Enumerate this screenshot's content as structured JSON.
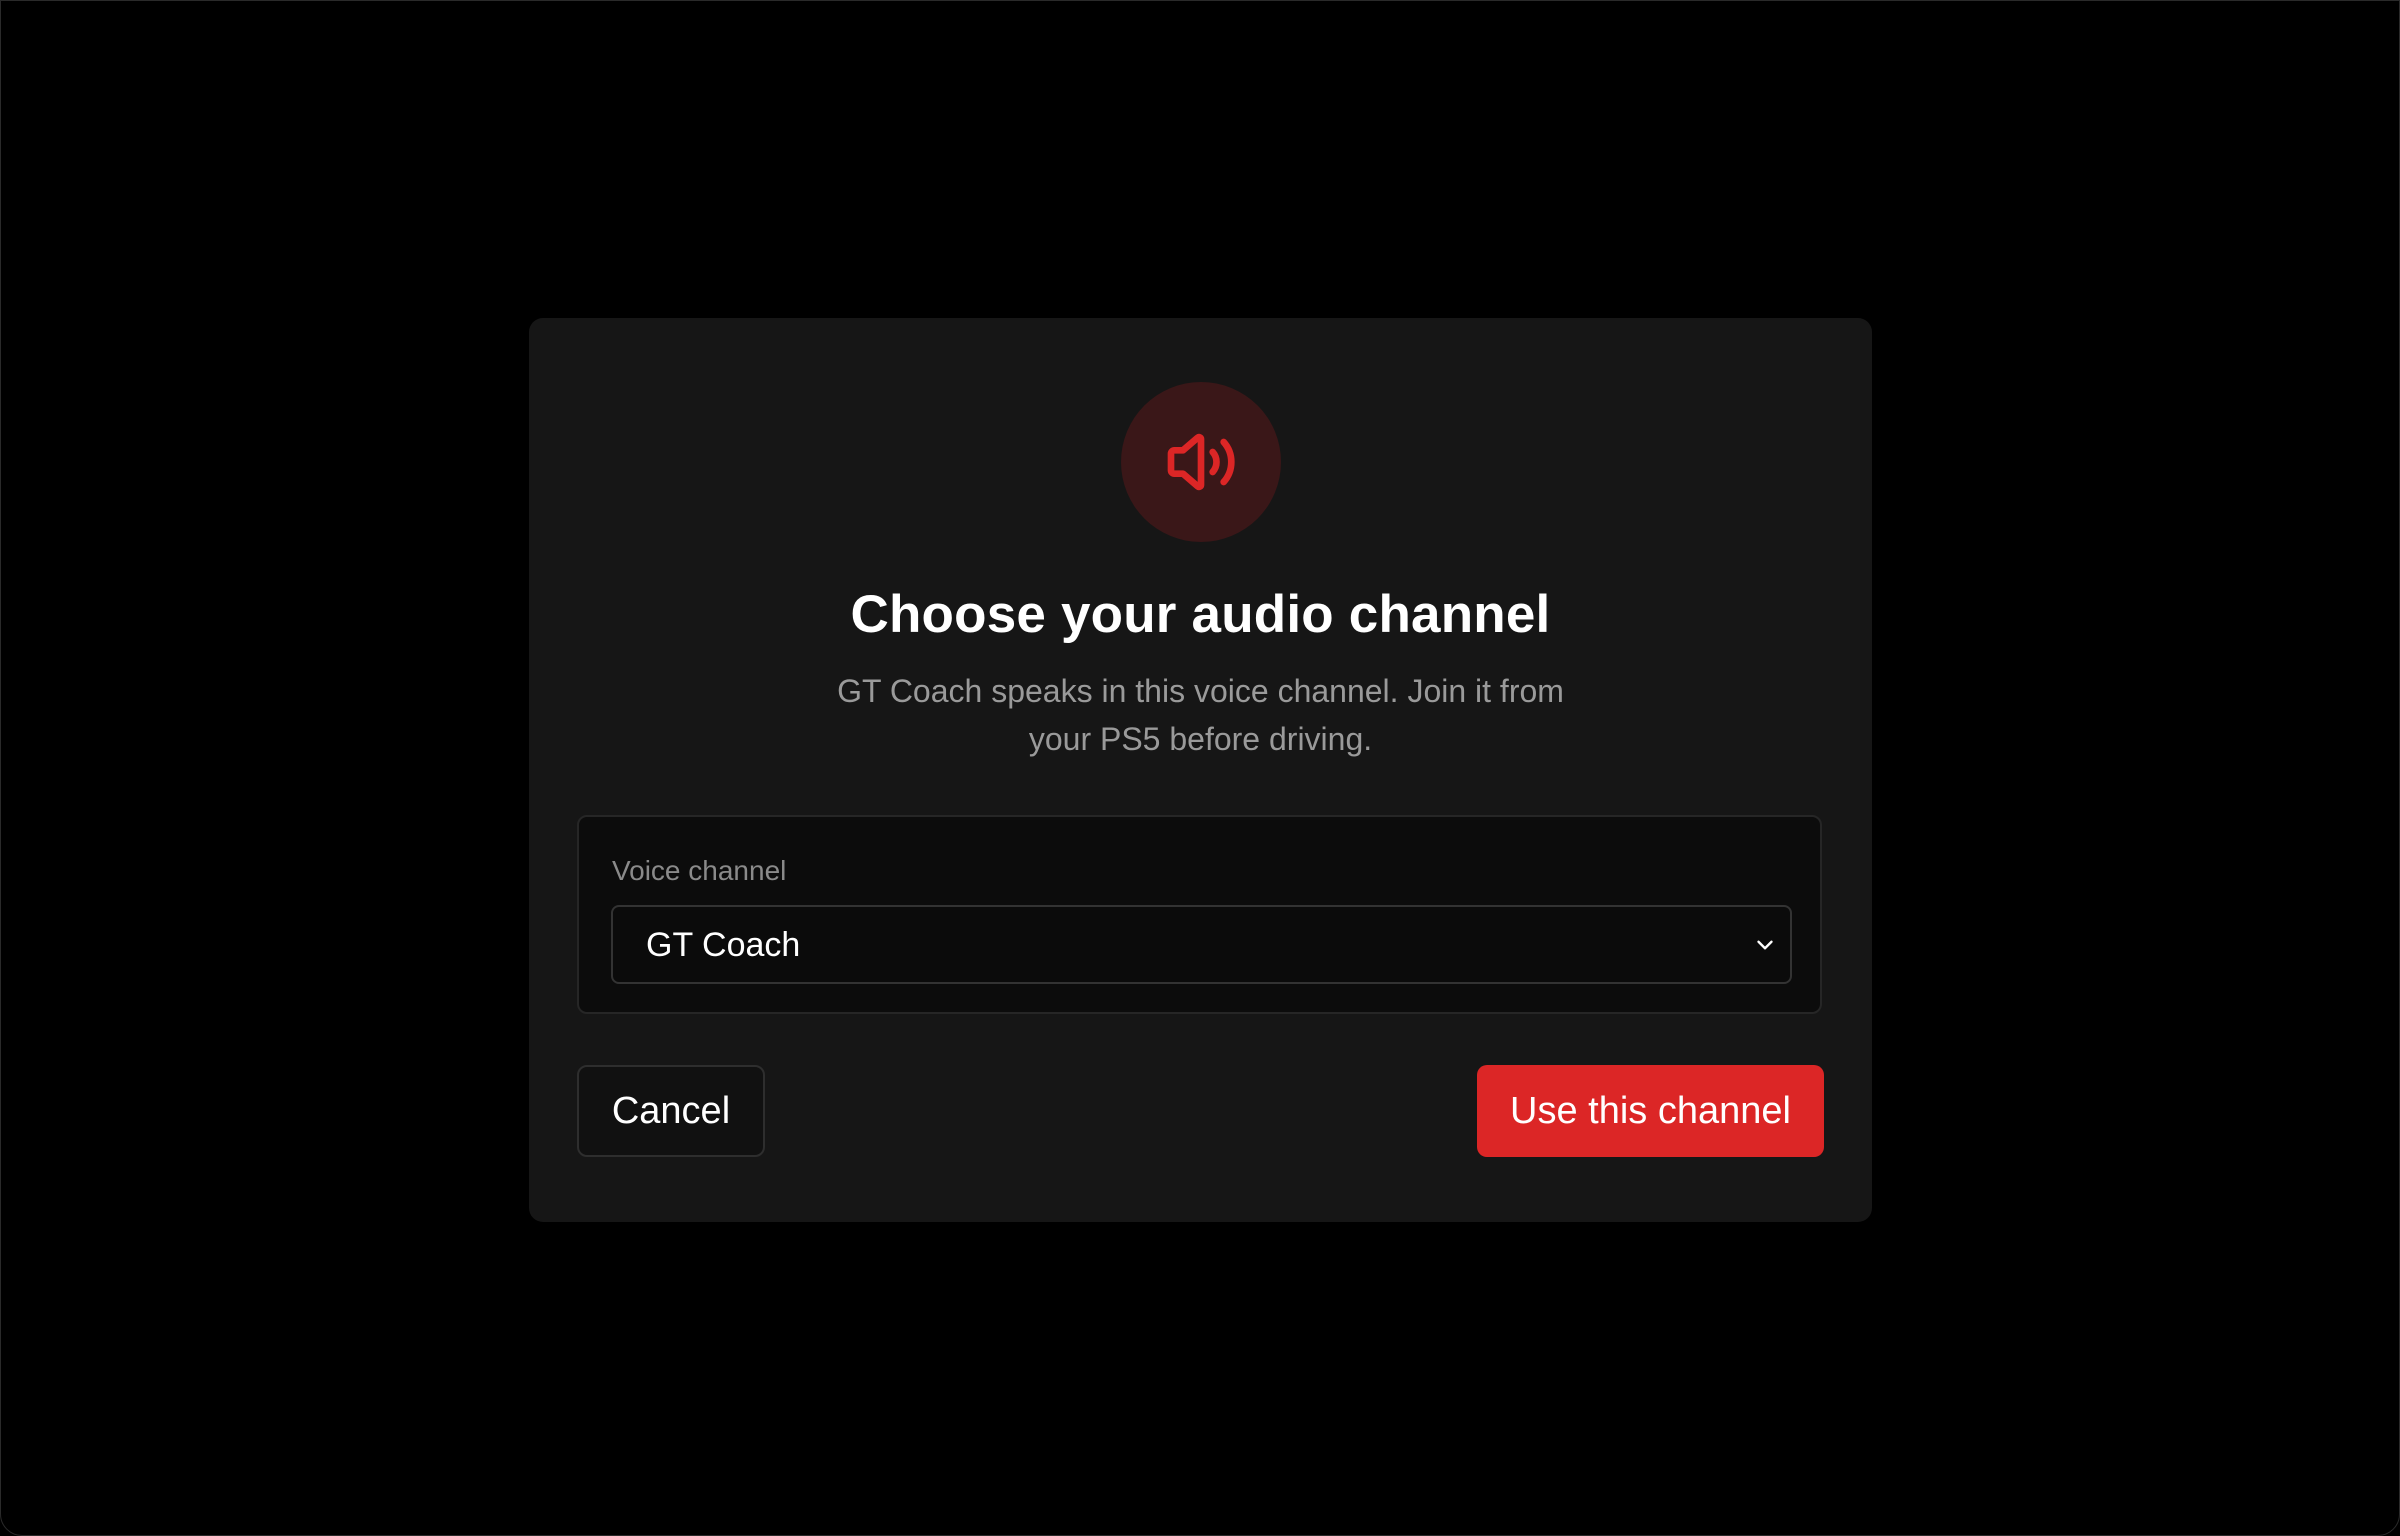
{
  "dialog": {
    "icon": "speaker-volume-icon",
    "title": "Choose your audio channel",
    "subtitle": "GT Coach speaks in this voice channel. Join it from your PS5 before driving."
  },
  "field": {
    "label": "Voice channel",
    "selected": "GT Coach",
    "chevron_icon": "chevron-down-icon"
  },
  "actions": {
    "cancel_label": "Cancel",
    "confirm_label": "Use this channel"
  },
  "colors": {
    "accent": "#dc2626",
    "icon_background": "#3a1718",
    "modal_background": "#161616",
    "page_background": "#000000"
  }
}
